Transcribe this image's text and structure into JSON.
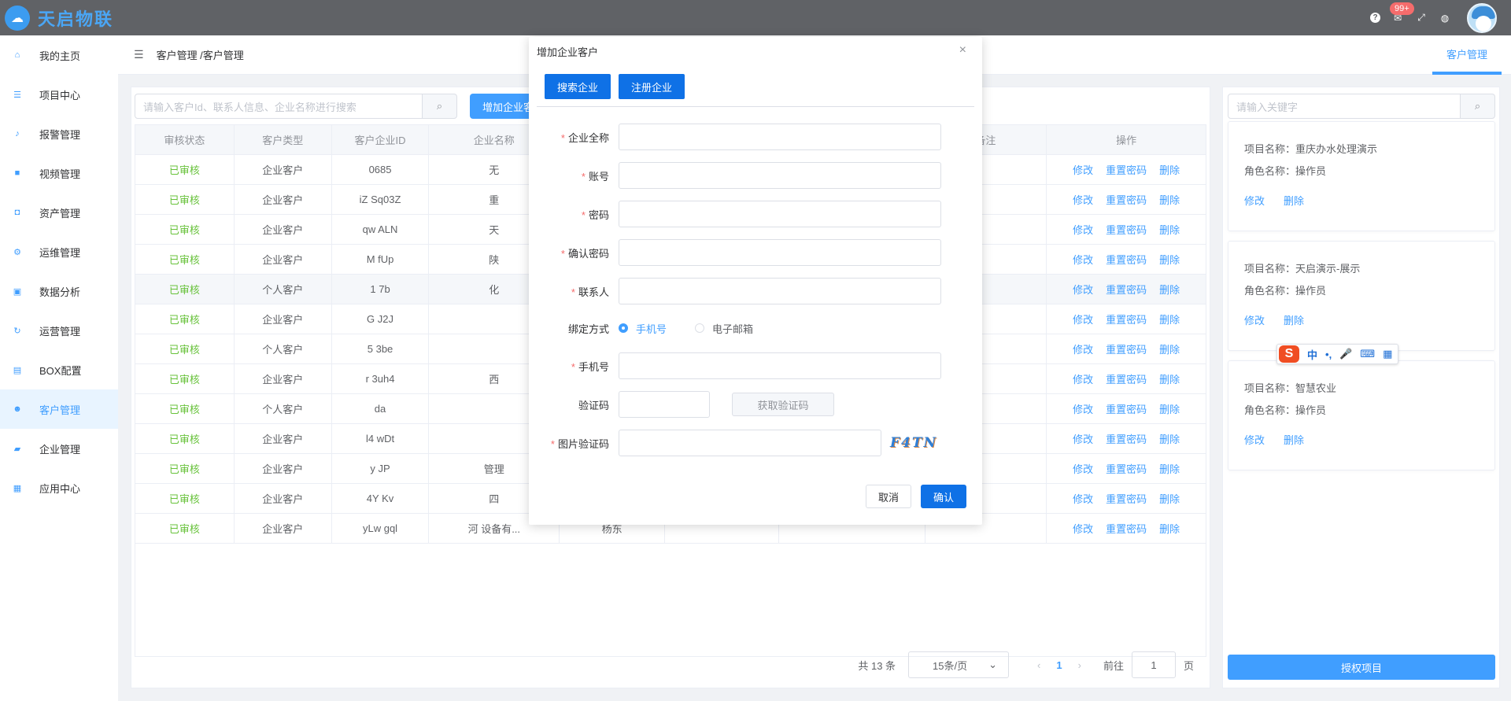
{
  "app": {
    "logo_text": "天启物联",
    "badge": "99+"
  },
  "sidebar": {
    "items": [
      {
        "label": "我的主页",
        "icon": "home-icon"
      },
      {
        "label": "项目中心",
        "icon": "stack-icon"
      },
      {
        "label": "报警管理",
        "icon": "bell-icon"
      },
      {
        "label": "视频管理",
        "icon": "camera-icon"
      },
      {
        "label": "资产管理",
        "icon": "asset-icon"
      },
      {
        "label": "运维管理",
        "icon": "gear-icon"
      },
      {
        "label": "数据分析",
        "icon": "chart-icon"
      },
      {
        "label": "运营管理",
        "icon": "cycle-icon"
      },
      {
        "label": "BOX配置",
        "icon": "box-icon"
      },
      {
        "label": "客户管理",
        "icon": "users-icon"
      },
      {
        "label": "企业管理",
        "icon": "briefcase-icon"
      },
      {
        "label": "应用中心",
        "icon": "grid-icon"
      }
    ]
  },
  "breadcrumb": "客户管理 /客户管理",
  "right_tab": "客户管理",
  "main": {
    "search_placeholder": "请输入客户Id、联系人信息、企业名称进行搜索",
    "add_button": "增加企业客",
    "columns": [
      "审核状态",
      "客户类型",
      "客户企业ID",
      "企业名称",
      "",
      "",
      "",
      "备注",
      "操作"
    ],
    "rows": [
      {
        "status": "已审核",
        "type": "企业客户",
        "id": "0685",
        "name": "无",
        "extra": ""
      },
      {
        "status": "已审核",
        "type": "企业客户",
        "id": "iZ   Sq03Z",
        "name": "重",
        "extra": ""
      },
      {
        "status": "已审核",
        "type": "企业客户",
        "id": "qw   ALN",
        "name": "天",
        "extra": ""
      },
      {
        "status": "已审核",
        "type": "企业客户",
        "id": "M   fUp",
        "name": "陕",
        "extra": ""
      },
      {
        "status": "已审核",
        "type": "个人客户",
        "id": "1   7b",
        "name": "化",
        "extra": ""
      },
      {
        "status": "已审核",
        "type": "企业客户",
        "id": "G   J2J",
        "name": "",
        "extra": ""
      },
      {
        "status": "已审核",
        "type": "个人客户",
        "id": "5   3be",
        "name": "",
        "extra": ""
      },
      {
        "status": "已审核",
        "type": "企业客户",
        "id": "r   3uh4",
        "name": "西",
        "extra": ""
      },
      {
        "status": "已审核",
        "type": "个人客户",
        "id": "da",
        "name": "",
        "extra": ""
      },
      {
        "status": "已审核",
        "type": "企业客户",
        "id": "l4   wDt",
        "name": "",
        "extra": ""
      },
      {
        "status": "已审核",
        "type": "企业客户",
        "id": "y   JP",
        "name": "管理",
        "extra": ""
      },
      {
        "status": "已审核",
        "type": "企业客户",
        "id": "4Y   Kv",
        "name": "四",
        "extra": ""
      },
      {
        "status": "已审核",
        "type": "企业客户",
        "id": "yLw   gql",
        "name": "河   设备有...",
        "extra": "杨东"
      }
    ],
    "ops": [
      "修改",
      "重置密码",
      "删除"
    ],
    "pager": {
      "total": "共 13 条",
      "size": "15条/页",
      "page": "1",
      "goto": "前往",
      "goto_value": "1",
      "page_unit": "页"
    }
  },
  "right": {
    "search_placeholder": "请输入关键字",
    "cards": [
      {
        "project": "项目名称：重庆办水处理演示",
        "role": "角色名称：操作员"
      },
      {
        "project": "项目名称：天启演示-展示",
        "role": "角色名称：操作员"
      },
      {
        "project": "项目名称：智慧农业",
        "role": "角色名称：操作员"
      }
    ],
    "edit": "修改",
    "delete": "删除",
    "auth_button": "授权项目"
  },
  "ime": {
    "logo": "S",
    "k1": "中",
    "k2": "•,",
    "k3": "🎤",
    "k4": "⌨",
    "k5": "▦"
  },
  "dialog": {
    "title": "增加企业客户",
    "tab_search": "搜索企业",
    "tab_register": "注册企业",
    "fields": {
      "company": "企业全称",
      "account": "账号",
      "password": "密码",
      "confirm": "确认密码",
      "contact": "联系人",
      "bind": "绑定方式",
      "phone": "手机号",
      "code": "验证码",
      "img_code": "图片验证码"
    },
    "bind_phone": "手机号",
    "bind_email": "电子邮箱",
    "get_code": "获取验证码",
    "captcha": "F4TN",
    "cancel": "取消",
    "ok": "确认"
  }
}
